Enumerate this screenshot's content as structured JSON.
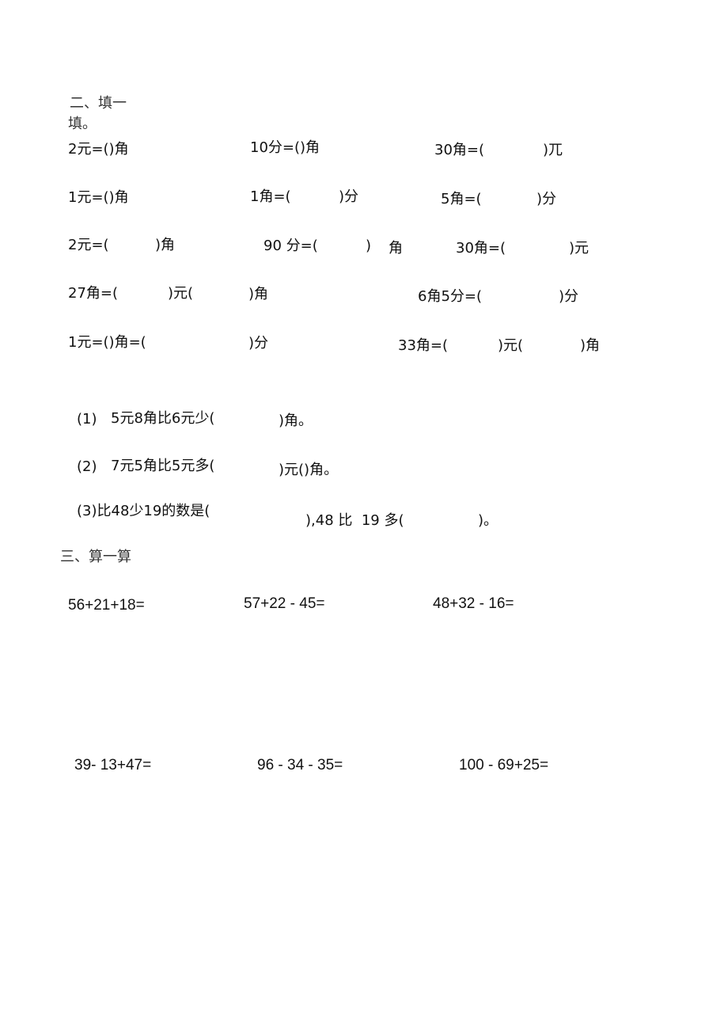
{
  "section2": {
    "heading_line1": "二、填一",
    "heading_line2": "填。",
    "rows": [
      [
        "2元=()角",
        "10分=()角",
        "30角=(",
        ")兀"
      ],
      [
        "1元=()角",
        "1角=(",
        ")分",
        "5角=(",
        ")分"
      ],
      [
        "2元=(",
        ")角",
        "90 分=(",
        ")",
        "角",
        "30角=(",
        ")元"
      ],
      [
        "27角=(",
        ")元(",
        ")角",
        "6角5分=(",
        ")分"
      ],
      [
        "1元=()角=(",
        ")分",
        "33角=(",
        ")元(",
        ")角"
      ]
    ],
    "questions": [
      [
        "(1)",
        "5元8角比6元少(",
        ")角。"
      ],
      [
        "(2)",
        "7元5角比5元多(",
        ")元()角。"
      ],
      [
        "(3)比48少19的数是(",
        "),48 比  19 多(",
        ")。"
      ]
    ]
  },
  "section3": {
    "heading": "三、算一算",
    "problems_row1": [
      "56+21+18=",
      "57+22 - 45=",
      "48+32 - 16="
    ],
    "problems_row2": [
      "39- 13+47=",
      "96 - 34 - 35=",
      "100 - 69+25="
    ]
  }
}
